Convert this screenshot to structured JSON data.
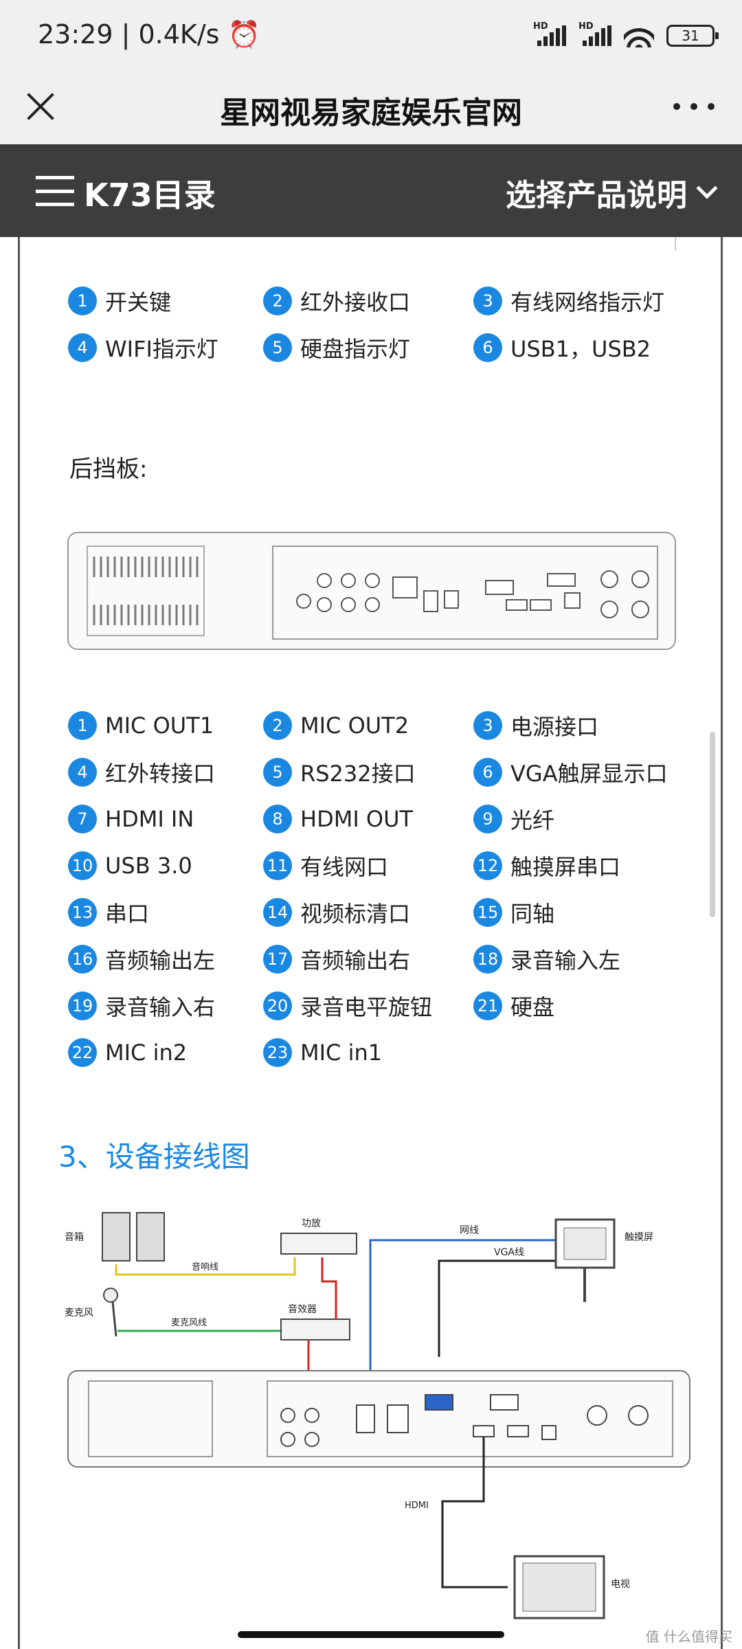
{
  "status": {
    "time": "23:29 | 0.4K/s ⏰",
    "signal1": "HD",
    "signal2": "HD",
    "battery": "31"
  },
  "titlebar": {
    "title": "星网视易家庭娱乐官网"
  },
  "catalog": {
    "title": "K73目录",
    "select_label": "选择产品说明"
  },
  "front_items": [
    {
      "n": "1",
      "label": "开关键"
    },
    {
      "n": "2",
      "label": "红外接收口"
    },
    {
      "n": "3",
      "label": "有线网络指示灯"
    },
    {
      "n": "4",
      "label": "WIFI指示灯"
    },
    {
      "n": "5",
      "label": "硬盘指示灯"
    },
    {
      "n": "6",
      "label": "USB1，USB2"
    }
  ],
  "rear_panel_label": "后挡板:",
  "rear_items": [
    {
      "n": "1",
      "label": "MIC OUT1"
    },
    {
      "n": "2",
      "label": "MIC OUT2"
    },
    {
      "n": "3",
      "label": "电源接口"
    },
    {
      "n": "4",
      "label": "红外转接口"
    },
    {
      "n": "5",
      "label": "RS232接口"
    },
    {
      "n": "6",
      "label": "VGA触屏显示口"
    },
    {
      "n": "7",
      "label": "HDMI IN"
    },
    {
      "n": "8",
      "label": "HDMI OUT"
    },
    {
      "n": "9",
      "label": "光纤"
    },
    {
      "n": "10",
      "label": "USB 3.0"
    },
    {
      "n": "11",
      "label": "有线网口"
    },
    {
      "n": "12",
      "label": "触摸屏串口"
    },
    {
      "n": "13",
      "label": "串口"
    },
    {
      "n": "14",
      "label": "视频标清口"
    },
    {
      "n": "15",
      "label": "同轴"
    },
    {
      "n": "16",
      "label": "音频输出左"
    },
    {
      "n": "17",
      "label": "音频输出右"
    },
    {
      "n": "18",
      "label": "录音输入左"
    },
    {
      "n": "19",
      "label": "录音输入右"
    },
    {
      "n": "20",
      "label": "录音电平旋钮"
    },
    {
      "n": "21",
      "label": "硬盘"
    },
    {
      "n": "22",
      "label": "MIC in2"
    },
    {
      "n": "23",
      "label": "MIC in1"
    }
  ],
  "wiring_section_title": "3、设备接线图",
  "wiring": {
    "speaker": "音箱",
    "amp": "功放",
    "speaker_cable": "音响线",
    "mic": "麦克风",
    "mic_cable": "麦克风线",
    "mixer": "音效器",
    "network_cable": "网线",
    "vga_cable": "VGA线",
    "touch_screen": "触摸屏",
    "hdmi": "HDMI",
    "tv": "电视"
  },
  "watermark": "值 什么值得买"
}
